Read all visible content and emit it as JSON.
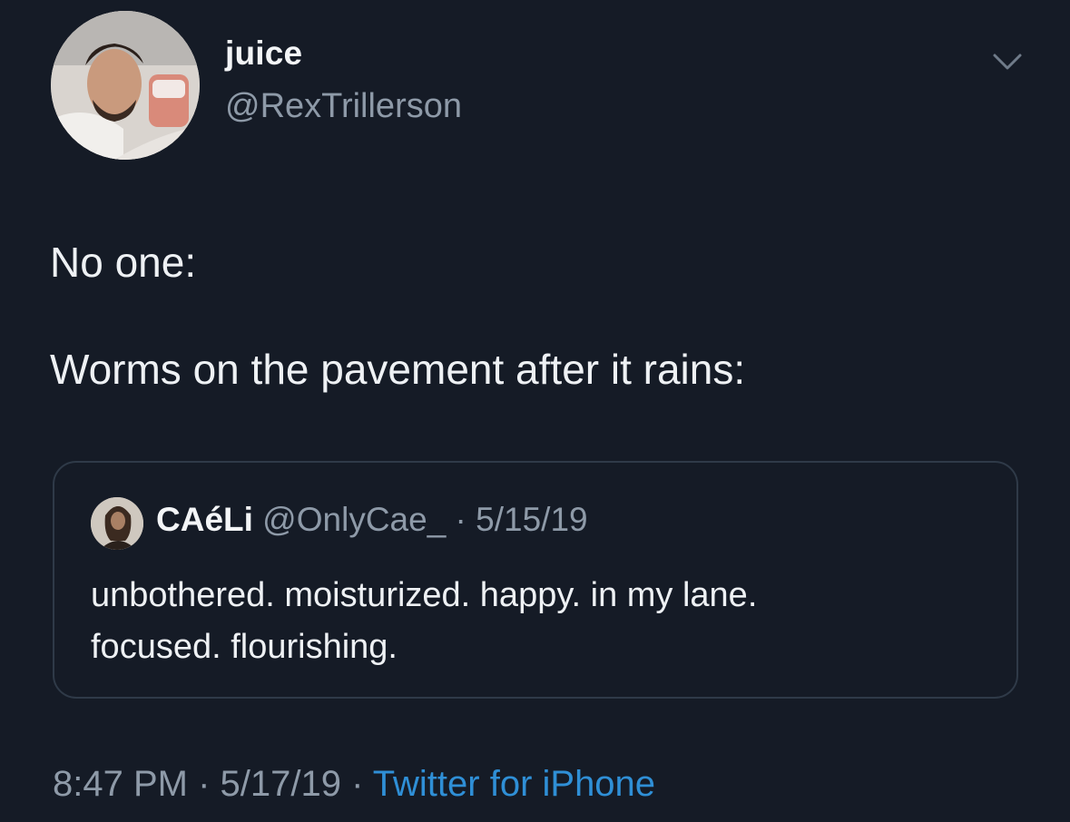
{
  "author": {
    "display_name": "juice",
    "handle": "@RexTrillerson",
    "avatar_icon": "profile-photo-avatar"
  },
  "menu": {
    "icon": "chevron-down-icon"
  },
  "tweet": {
    "line1": "No one:",
    "line2": "Worms on the pavement after it rains:"
  },
  "quoted_tweet": {
    "display_name": "CAéLi",
    "meta": " @OnlyCae_ · 5/15/19",
    "text_line1": "unbothered. moisturized. happy. in my lane.",
    "text_line2": "focused. flourishing.",
    "avatar_icon": "profile-photo-avatar"
  },
  "footer": {
    "timestamp": "8:47 PM · 5/17/19 · ",
    "source": "Twitter for iPhone"
  },
  "colors": {
    "background": "#151b26",
    "text": "#eef1f4",
    "secondary": "#8e9aa8",
    "link": "#2f8fd6",
    "border": "#2f3a48"
  }
}
